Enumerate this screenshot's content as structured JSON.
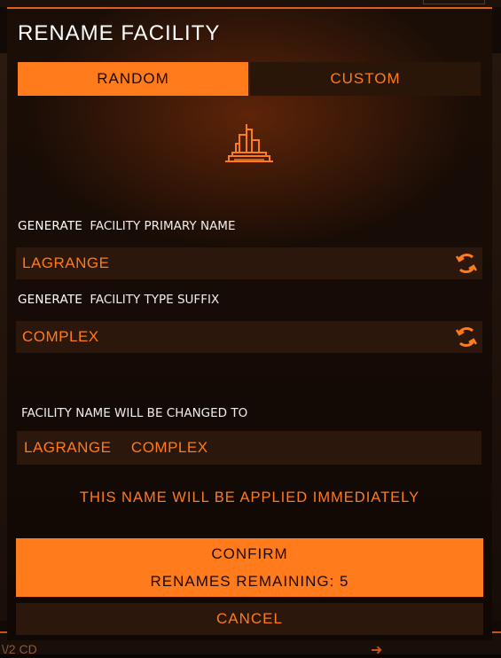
{
  "dialog": {
    "title": "RENAME FACILITY",
    "tabs": {
      "random": "RANDOM",
      "custom": "CUSTOM"
    },
    "icon": "facility-building-icon",
    "primary_name": {
      "label_prefix": "GENERATE",
      "label_rest": "FACILITY PRIMARY NAME",
      "value": "LAGRANGE",
      "refresh_icon": "refresh-icon"
    },
    "type_suffix": {
      "label_prefix": "GENERATE",
      "label_rest": "FACILITY TYPE SUFFIX",
      "value": "COMPLEX",
      "refresh_icon": "refresh-icon"
    },
    "preview": {
      "label": "FACILITY NAME WILL BE CHANGED TO",
      "value": "LAGRANGE  COMPLEX"
    },
    "notice": "THIS NAME WILL BE APPLIED IMMEDIATELY",
    "confirm": {
      "label": "CONFIRM",
      "remaining": "RENAMES REMAINING: 5"
    },
    "cancel": "CANCEL"
  },
  "background": {
    "bottom_text": "\\/2 CD"
  },
  "colors": {
    "accent": "#ff7b1c",
    "field_bg": "#2b170b",
    "modal_bg": "#1b0e07"
  }
}
